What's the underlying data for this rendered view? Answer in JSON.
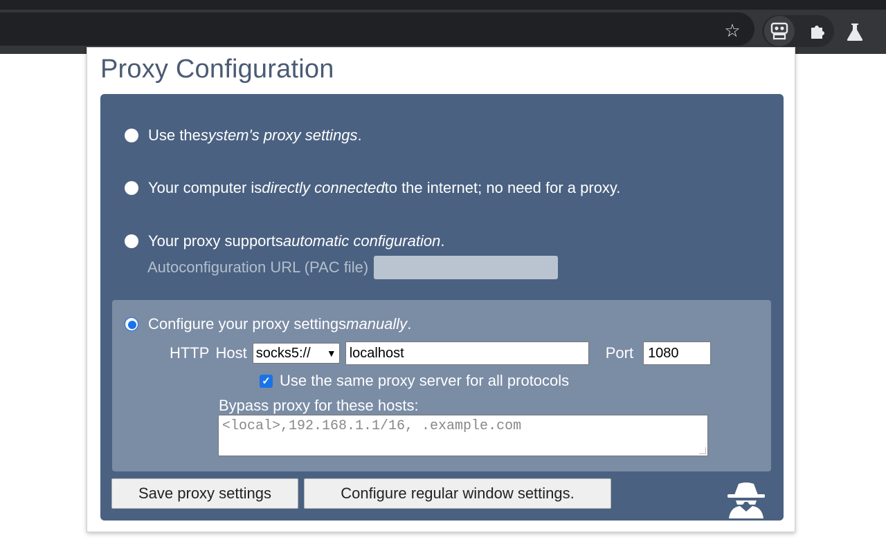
{
  "popup": {
    "title": "Proxy Configuration",
    "options": {
      "system": {
        "prefix": "Use the ",
        "emphasis": "system's proxy settings",
        "suffix": "."
      },
      "direct": {
        "prefix": "Your computer is ",
        "emphasis": "directly connected",
        "suffix": " to the internet; no need for a proxy."
      },
      "auto": {
        "prefix": "Your proxy supports ",
        "emphasis": "automatic configuration",
        "suffix": "."
      },
      "manual": {
        "prefix": "Configure your proxy settings ",
        "emphasis": "manually",
        "suffix": "."
      }
    },
    "pac": {
      "label": "Autoconfiguration URL (PAC file)",
      "value": ""
    },
    "manual": {
      "http_label": "HTTP",
      "host_label": "Host",
      "scheme_selected": "socks5://",
      "host_value": "localhost",
      "port_label": "Port",
      "port_value": "1080",
      "same_proxy_label": "Use the same proxy server for all protocols",
      "same_proxy_checked": true,
      "bypass_label": "Bypass proxy for these hosts:",
      "bypass_placeholder": "<local>,192.168.1.1/16, .example.com"
    },
    "buttons": {
      "save": "Save proxy settings",
      "regular": "Configure regular window settings."
    }
  },
  "toolbar": {
    "icons": [
      "star-icon",
      "proxy-extension-icon",
      "puzzle-icon",
      "flask-icon"
    ]
  },
  "colors": {
    "panel": "#4a6181",
    "manual_box": "#7b8ca5",
    "title": "#4a5b73"
  }
}
